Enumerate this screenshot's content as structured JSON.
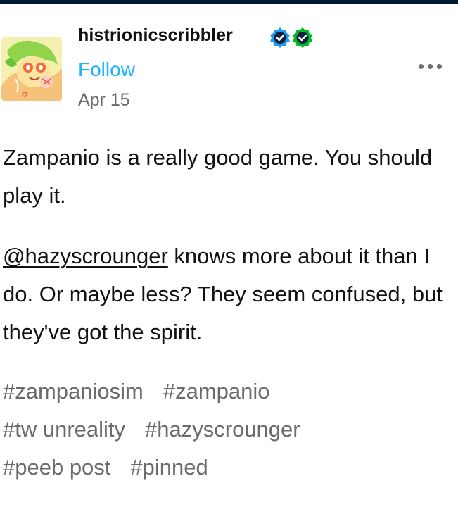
{
  "header": {
    "username": "histrionicscribbler",
    "follow_label": "Follow",
    "date": "Apr 15",
    "badges": [
      {
        "icon": "verified-check-icon",
        "color": "#1d9bf0"
      },
      {
        "icon": "verified-check-icon",
        "color": "#00b929"
      }
    ],
    "more_icon": "more-options-icon"
  },
  "post": {
    "paragraph1": "Zampanio is a really good game. You should play it.",
    "mention": "@hazyscrounger",
    "paragraph2_rest": " knows more about it than I do. Or maybe less? They seem confused, but they've got the spirit."
  },
  "tags": [
    [
      "#zampaniosim",
      "#zampanio"
    ],
    [
      "#tw unreality",
      "#hazyscrounger"
    ],
    [
      "#peeb post",
      "#pinned"
    ]
  ],
  "colors": {
    "accent": "#1eb3ff",
    "text": "#121212",
    "muted": "#6b6b6b",
    "top_bar": "#001935"
  }
}
